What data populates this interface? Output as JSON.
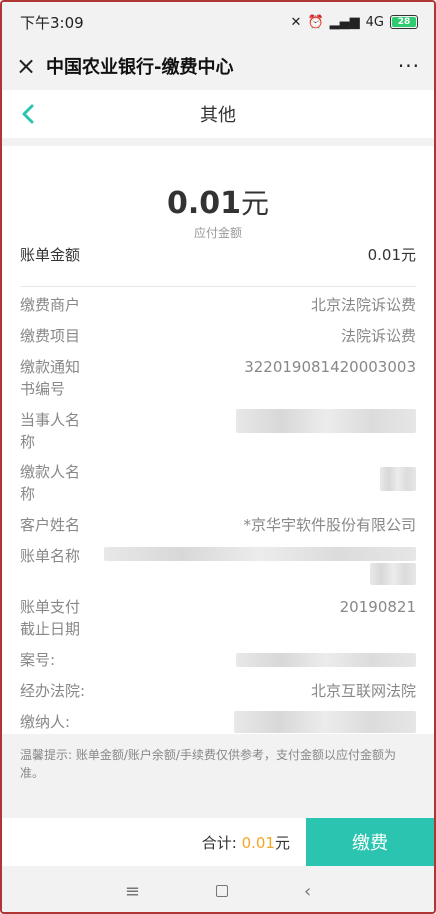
{
  "status": {
    "time": "下午3:09",
    "network": "4G",
    "battery": "28"
  },
  "titlebar": {
    "close": "×",
    "title": "中国农业银行-缴费中心",
    "more": "···"
  },
  "navbar": {
    "title": "其他"
  },
  "amount": {
    "value": "0.01",
    "unit": "元",
    "caption": "应付金额"
  },
  "bill": {
    "label": "账单金额",
    "value": "0.01元"
  },
  "details": [
    {
      "label": "缴费商户",
      "value": "北京法院诉讼费"
    },
    {
      "label": "缴费项目",
      "value": "法院诉讼费"
    },
    {
      "label": "缴款通知书编号",
      "value": "322019081420003003"
    },
    {
      "label": "当事人名称",
      "value": ""
    },
    {
      "label": "缴款人名称",
      "value": ""
    },
    {
      "label": "客户姓名",
      "value": "*京华宇软件股份有限公司"
    },
    {
      "label": "账单名称",
      "value": ""
    },
    {
      "label": "账单支付截止日期",
      "value": "20190821"
    },
    {
      "label": "案号:",
      "value": ""
    },
    {
      "label": "经办法院:",
      "value": "北京互联网法院"
    },
    {
      "label": "缴纳人:",
      "value": ""
    }
  ],
  "tip": "温馨提示: 账单金额/账户余额/手续费仅供参考，支付金额以应付金额为准。",
  "footer": {
    "total_label": "合计: ",
    "total_value": "0.01",
    "total_unit": "元",
    "pay_label": "缴费"
  },
  "colors": {
    "accent": "#2bc4b0",
    "highlight": "#f5a623"
  },
  "sysnav": {
    "menu": "≡",
    "back": "‹"
  }
}
